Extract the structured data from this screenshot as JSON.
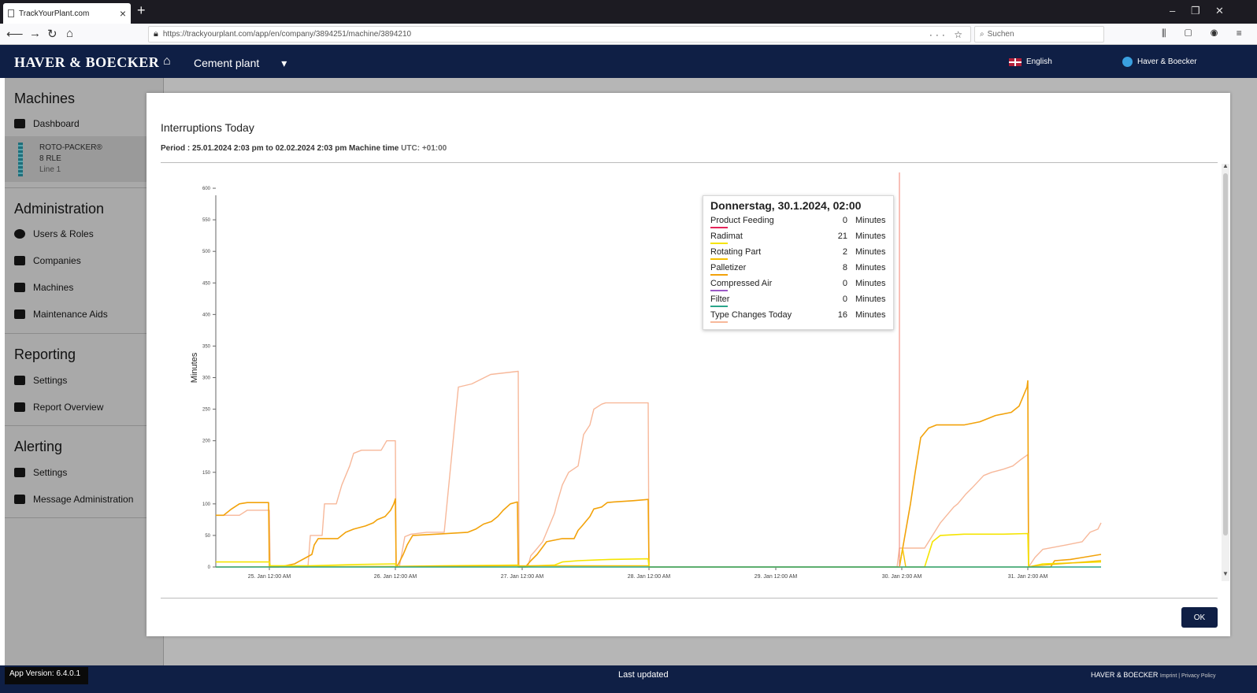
{
  "browser": {
    "tab_title": "TrackYourPlant.com",
    "url": "https://trackyourplant.com/app/en/company/3894251/machine/3894210",
    "search_placeholder": "Suchen"
  },
  "header": {
    "brand": "HAVER & BOECKER",
    "plant": "Cement plant",
    "language": "English",
    "account": "Haver & Boecker"
  },
  "sidebar": {
    "machines_heading": "Machines",
    "dashboard": "Dashboard",
    "machine_card": {
      "line1": "ROTO-PACKER®",
      "line2": "8 RLE",
      "line3": "Line 1"
    },
    "administration_heading": "Administration",
    "admin_items": [
      {
        "label": "Users & Roles"
      },
      {
        "label": "Companies"
      },
      {
        "label": "Machines"
      },
      {
        "label": "Maintenance Aids"
      }
    ],
    "reporting_heading": "Reporting",
    "reporting_items": [
      {
        "label": "Settings"
      },
      {
        "label": "Report Overview"
      }
    ],
    "alerting_heading": "Alerting",
    "alerting_items": [
      {
        "label": "Settings"
      },
      {
        "label": "Message Administration"
      }
    ]
  },
  "modal": {
    "title": "Interruptions Today",
    "period": "Period : 25.01.2024 2:03 pm to 02.02.2024 2:03 pm Machine time",
    "utc": "UTC: +01:00",
    "ok_label": "OK"
  },
  "tooltip": {
    "title": "Donnerstag, 30.1.2024, 02:00",
    "rows": [
      {
        "name": "Product Feeding",
        "value": "0",
        "unit": "Minutes",
        "color": "#e4245a"
      },
      {
        "name": "Radimat",
        "value": "21",
        "unit": "Minutes",
        "color": "#f5e400"
      },
      {
        "name": "Rotating Part",
        "value": "2",
        "unit": "Minutes",
        "color": "#f5c000"
      },
      {
        "name": "Palletizer",
        "value": "8",
        "unit": "Minutes",
        "color": "#f2a20a"
      },
      {
        "name": "Compressed Air",
        "value": "0",
        "unit": "Minutes",
        "color": "#9b59c6"
      },
      {
        "name": "Filter",
        "value": "0",
        "unit": "Minutes",
        "color": "#2aa58a"
      },
      {
        "name": "Type Changes Today",
        "value": "16",
        "unit": "Minutes",
        "color": "#f7b89a"
      }
    ]
  },
  "footer": {
    "app_version": "App Version: 6.4.0.1",
    "last_updated": "Last updated",
    "brand": "HAVER & BOECKER",
    "links": "Imprint | Privacy Policy"
  },
  "chart_data": {
    "type": "line",
    "ylabel": "Minutes",
    "ylim": [
      0,
      620
    ],
    "yticks": [
      0,
      50,
      100,
      150,
      200,
      250,
      300,
      350,
      400,
      450,
      500,
      550,
      600
    ],
    "xlim": [
      0,
      1124
    ],
    "x_ticks": [
      {
        "label": "25. Jan 12:00 AM",
        "x": 68
      },
      {
        "label": "26. Jan 12:00 AM",
        "x": 228
      },
      {
        "label": "27. Jan 12:00 AM",
        "x": 389
      },
      {
        "label": "28. Jan 12:00 AM",
        "x": 550
      },
      {
        "label": "29. Jan 12:00 AM",
        "x": 711
      },
      {
        "label": "30. Jan 2:00 AM",
        "x": 871
      },
      {
        "label": "31. Jan 2:00 AM",
        "x": 1031
      }
    ],
    "crosshair_x": 868,
    "grid": false,
    "series": [
      {
        "name": "Type Changes Today",
        "color": "#f7b89a",
        "points": [
          [
            0,
            82
          ],
          [
            30,
            82
          ],
          [
            40,
            90
          ],
          [
            68,
            90
          ],
          [
            69,
            0
          ],
          [
            117,
            0
          ],
          [
            120,
            50
          ],
          [
            135,
            50
          ],
          [
            138,
            100
          ],
          [
            153,
            100
          ],
          [
            160,
            130
          ],
          [
            170,
            160
          ],
          [
            175,
            180
          ],
          [
            185,
            185
          ],
          [
            210,
            185
          ],
          [
            217,
            200
          ],
          [
            228,
            200
          ],
          [
            229,
            0
          ],
          [
            233,
            0
          ],
          [
            236,
            20
          ],
          [
            240,
            48
          ],
          [
            248,
            52
          ],
          [
            268,
            55
          ],
          [
            290,
            55
          ],
          [
            308,
            285
          ],
          [
            325,
            290
          ],
          [
            349,
            305
          ],
          [
            384,
            310
          ],
          [
            385,
            0
          ],
          [
            396,
            0
          ],
          [
            400,
            18
          ],
          [
            405,
            25
          ],
          [
            415,
            40
          ],
          [
            430,
            85
          ],
          [
            433,
            100
          ],
          [
            440,
            130
          ],
          [
            448,
            150
          ],
          [
            460,
            160
          ],
          [
            467,
            210
          ],
          [
            475,
            225
          ],
          [
            480,
            250
          ],
          [
            490,
            258
          ],
          [
            495,
            260
          ],
          [
            549,
            260
          ],
          [
            550,
            0
          ],
          [
            865,
            0
          ],
          [
            868,
            30
          ],
          [
            900,
            30
          ],
          [
            920,
            70
          ],
          [
            937,
            95
          ],
          [
            942,
            100
          ],
          [
            952,
            115
          ],
          [
            960,
            125
          ],
          [
            975,
            145
          ],
          [
            985,
            150
          ],
          [
            1000,
            155
          ],
          [
            1012,
            160
          ],
          [
            1022,
            170
          ],
          [
            1031,
            178
          ],
          [
            1032,
            0
          ],
          [
            1040,
            15
          ],
          [
            1050,
            28
          ],
          [
            1080,
            35
          ],
          [
            1100,
            40
          ],
          [
            1110,
            55
          ],
          [
            1120,
            60
          ],
          [
            1124,
            70
          ]
        ]
      },
      {
        "name": "Palletizer",
        "color": "#f2a20a",
        "points": [
          [
            0,
            82
          ],
          [
            10,
            82
          ],
          [
            20,
            92
          ],
          [
            30,
            100
          ],
          [
            40,
            102
          ],
          [
            67,
            102
          ],
          [
            68,
            0
          ],
          [
            80,
            0
          ],
          [
            100,
            5
          ],
          [
            122,
            20
          ],
          [
            125,
            35
          ],
          [
            130,
            45
          ],
          [
            155,
            45
          ],
          [
            165,
            55
          ],
          [
            175,
            60
          ],
          [
            190,
            65
          ],
          [
            200,
            70
          ],
          [
            205,
            75
          ],
          [
            215,
            80
          ],
          [
            222,
            90
          ],
          [
            226,
            100
          ],
          [
            228,
            108
          ],
          [
            229,
            0
          ],
          [
            232,
            5
          ],
          [
            238,
            20
          ],
          [
            243,
            35
          ],
          [
            250,
            50
          ],
          [
            280,
            52
          ],
          [
            320,
            55
          ],
          [
            330,
            60
          ],
          [
            340,
            68
          ],
          [
            350,
            72
          ],
          [
            358,
            80
          ],
          [
            365,
            90
          ],
          [
            374,
            100
          ],
          [
            383,
            103
          ],
          [
            384,
            0
          ],
          [
            393,
            0
          ],
          [
            400,
            10
          ],
          [
            408,
            20
          ],
          [
            414,
            30
          ],
          [
            420,
            40
          ],
          [
            440,
            45
          ],
          [
            455,
            45
          ],
          [
            460,
            58
          ],
          [
            465,
            65
          ],
          [
            475,
            80
          ],
          [
            480,
            92
          ],
          [
            490,
            95
          ],
          [
            497,
            102
          ],
          [
            505,
            103
          ],
          [
            530,
            105
          ],
          [
            549,
            107
          ],
          [
            550,
            0
          ],
          [
            868,
            0
          ],
          [
            875,
            50
          ],
          [
            882,
            100
          ],
          [
            888,
            150
          ],
          [
            895,
            205
          ],
          [
            905,
            220
          ],
          [
            915,
            225
          ],
          [
            950,
            225
          ],
          [
            970,
            230
          ],
          [
            990,
            240
          ],
          [
            1010,
            245
          ],
          [
            1020,
            255
          ],
          [
            1025,
            270
          ],
          [
            1030,
            285
          ],
          [
            1031,
            295
          ],
          [
            1032,
            0
          ],
          [
            1060,
            0
          ],
          [
            1065,
            10
          ],
          [
            1085,
            12
          ],
          [
            1100,
            15
          ],
          [
            1124,
            20
          ]
        ]
      },
      {
        "name": "Radimat",
        "color": "#f5e400",
        "points": [
          [
            0,
            8
          ],
          [
            68,
            8
          ],
          [
            69,
            2
          ],
          [
            120,
            2
          ],
          [
            180,
            4
          ],
          [
            228,
            5
          ],
          [
            229,
            1
          ],
          [
            290,
            2
          ],
          [
            384,
            3
          ],
          [
            385,
            1
          ],
          [
            430,
            3
          ],
          [
            440,
            8
          ],
          [
            460,
            10
          ],
          [
            500,
            12
          ],
          [
            549,
            13
          ],
          [
            550,
            0
          ],
          [
            900,
            0
          ],
          [
            905,
            20
          ],
          [
            910,
            40
          ],
          [
            920,
            50
          ],
          [
            950,
            52
          ],
          [
            1000,
            52
          ],
          [
            1031,
            53
          ],
          [
            1032,
            0
          ],
          [
            1050,
            5
          ],
          [
            1124,
            8
          ]
        ]
      },
      {
        "name": "Rotating Part",
        "color": "#f5c000",
        "points": [
          [
            0,
            0
          ],
          [
            228,
            1
          ],
          [
            384,
            2
          ],
          [
            549,
            2
          ],
          [
            550,
            0
          ],
          [
            868,
            0
          ],
          [
            872,
            30
          ],
          [
            876,
            0
          ],
          [
            1031,
            0
          ],
          [
            1040,
            2
          ],
          [
            1124,
            10
          ]
        ]
      },
      {
        "name": "Filter",
        "color": "#2aa58a",
        "points": [
          [
            0,
            0
          ],
          [
            1124,
            0
          ]
        ]
      }
    ]
  }
}
